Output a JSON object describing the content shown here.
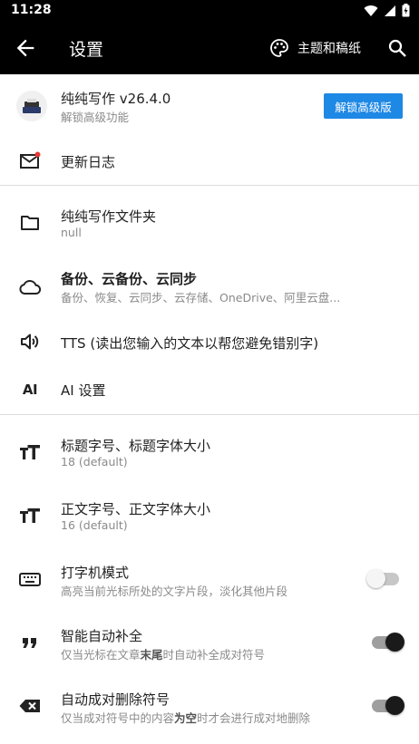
{
  "status_bar": {
    "time": "11:28"
  },
  "app_bar": {
    "title": "设置",
    "theme_label": "主题和稿纸"
  },
  "account": {
    "app_name": "纯纯写作 v26.4.0",
    "subtitle": "解锁高级功能",
    "unlock_button": "解锁高级版"
  },
  "items": {
    "changelog": {
      "title": "更新日志"
    },
    "folder": {
      "title": "纯纯写作文件夹",
      "subtitle": "null"
    },
    "backup": {
      "title": "备份、云备份、云同步",
      "subtitle": "备份、恢复、云同步、云存储、OneDrive、阿里云盘..."
    },
    "tts": {
      "title": "TTS (读出您输入的文本以帮您避免错别字)"
    },
    "ai": {
      "title": "AI 设置",
      "icon_text": "AI"
    },
    "title_font": {
      "title": "标题字号、标题字体大小",
      "subtitle": "18 (default)"
    },
    "body_font": {
      "title": "正文字号、正文字体大小",
      "subtitle": "16 (default)"
    },
    "typewriter": {
      "title": "打字机模式",
      "subtitle": "高亮当前光标所处的文字片段，淡化其他片段",
      "enabled": false
    },
    "autocomplete": {
      "title": "智能自动补全",
      "subtitle_a": "仅当光标在文章",
      "subtitle_b": "末尾",
      "subtitle_c": "时自动补全成对符号",
      "enabled": true
    },
    "autodelete": {
      "title": "自动成对删除符号",
      "subtitle_a": "仅当成对符号中的内容",
      "subtitle_b": "为空",
      "subtitle_c": "时才会进行成对地删除",
      "enabled": true
    }
  },
  "colors": {
    "accent": "#1e88e5",
    "badge": "#e53935",
    "appbar": "#000000"
  }
}
